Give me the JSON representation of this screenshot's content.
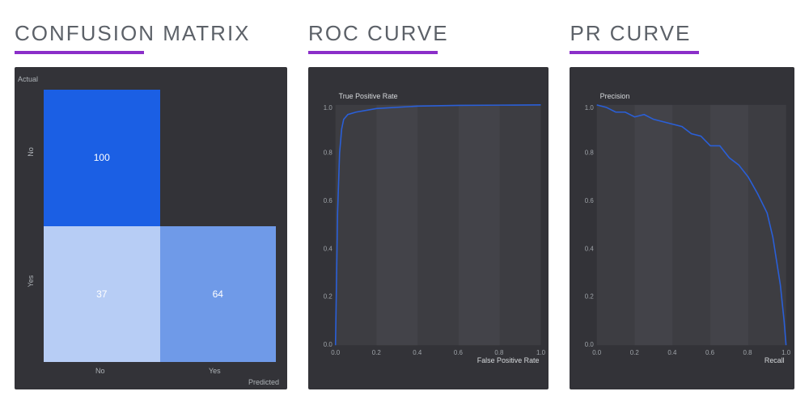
{
  "titles": {
    "confusion": "CONFUSION MATRIX",
    "roc": "ROC CURVE",
    "pr": "PR CURVE"
  },
  "confusion": {
    "actual_label": "Actual",
    "predicted_label": "Predicted",
    "row_labels": [
      "No",
      "Yes"
    ],
    "col_labels": [
      "No",
      "Yes"
    ],
    "cells": {
      "a": "100",
      "b": "",
      "c": "37",
      "d": "64"
    }
  },
  "roc": {
    "ylabel": "True Positive Rate",
    "xlabel": "False Positive Rate",
    "ticks": [
      "0.0",
      "0.2",
      "0.4",
      "0.6",
      "0.8",
      "1.0"
    ]
  },
  "pr": {
    "ylabel": "Precision",
    "xlabel": "Recall",
    "ticks": [
      "0.0",
      "0.2",
      "0.4",
      "0.6",
      "0.8",
      "1.0"
    ]
  },
  "chart_data": [
    {
      "type": "heatmap",
      "title": "Confusion Matrix",
      "xlabel": "Predicted",
      "ylabel": "Actual",
      "x_categories": [
        "No",
        "Yes"
      ],
      "y_categories": [
        "No",
        "Yes"
      ],
      "values": [
        [
          100,
          null
        ],
        [
          37,
          64
        ]
      ]
    },
    {
      "type": "line",
      "title": "ROC Curve",
      "xlabel": "False Positive Rate",
      "ylabel": "True Positive Rate",
      "xlim": [
        0,
        1
      ],
      "ylim": [
        0,
        1
      ],
      "series": [
        {
          "name": "ROC",
          "x": [
            0.0,
            0.01,
            0.02,
            0.03,
            0.04,
            0.06,
            0.1,
            0.2,
            0.4,
            0.6,
            0.8,
            1.0
          ],
          "y": [
            0.0,
            0.55,
            0.8,
            0.9,
            0.94,
            0.96,
            0.97,
            0.985,
            0.995,
            0.998,
            0.999,
            1.0
          ]
        }
      ]
    },
    {
      "type": "line",
      "title": "PR Curve",
      "xlabel": "Recall",
      "ylabel": "Precision",
      "xlim": [
        0,
        1
      ],
      "ylim": [
        0,
        1
      ],
      "series": [
        {
          "name": "PR",
          "x": [
            0.0,
            0.05,
            0.1,
            0.15,
            0.2,
            0.25,
            0.3,
            0.35,
            0.4,
            0.45,
            0.5,
            0.55,
            0.6,
            0.65,
            0.7,
            0.75,
            0.8,
            0.85,
            0.9,
            0.93,
            0.95,
            0.97,
            0.99,
            1.0
          ],
          "y": [
            1.0,
            0.99,
            0.97,
            0.97,
            0.95,
            0.96,
            0.94,
            0.93,
            0.92,
            0.91,
            0.88,
            0.87,
            0.83,
            0.83,
            0.78,
            0.75,
            0.7,
            0.63,
            0.55,
            0.45,
            0.35,
            0.25,
            0.1,
            0.0
          ]
        }
      ]
    }
  ]
}
